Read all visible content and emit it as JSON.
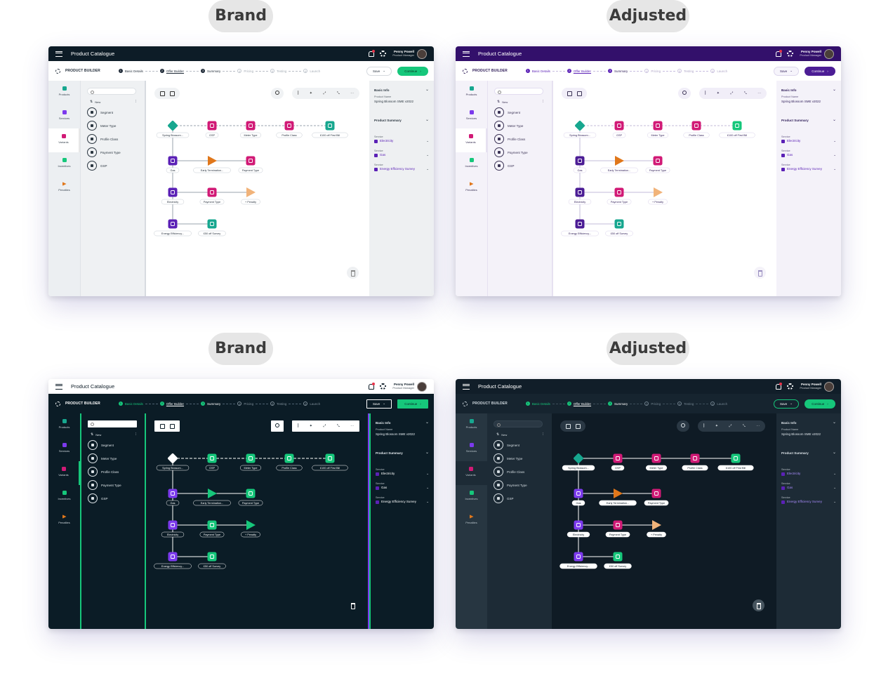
{
  "labels": {
    "top_left": "Brand",
    "top_right": "Adjusted",
    "bottom_left": "Brand",
    "bottom_right": "Adjusted"
  },
  "app": {
    "title": "Product Catalogue",
    "user_name": "Penny Powell",
    "user_role": "Product Manager",
    "builder_label": "PRODUCT BUILDER",
    "save_label": "Save",
    "continue_label": "Continue",
    "steps": [
      {
        "num": "1",
        "label": "Basic Details"
      },
      {
        "num": "2",
        "label": "Offer Builder"
      },
      {
        "num": "3",
        "label": "Summary"
      },
      {
        "num": "4",
        "label": "Pricing"
      },
      {
        "num": "5",
        "label": "Testing"
      },
      {
        "num": "6",
        "label": "Launch"
      }
    ],
    "nav": [
      "Products",
      "Services",
      "Variants",
      "Incentives",
      "Penalties"
    ],
    "new_label": "New",
    "items": [
      "Segment",
      "Meter Type",
      "Profile Class",
      "Payment Type",
      "GSP"
    ],
    "nodes": {
      "root": "Spring Blossom...",
      "gsp": "GSP",
      "meter": "Meter Type",
      "profile": "Profile Class",
      "first_bill": "£100 off First Bill",
      "gas": "Gas",
      "early": "Early Termination...",
      "pay1": "Payment Type",
      "elec": "Electricity",
      "pay2": "Payment Type",
      "penalty": "+ Penalty",
      "energy": "Energy Efficiency...",
      "survey": "£50 off Survey"
    },
    "panel": {
      "basic_info": "Basic Info",
      "product_name_label": "Product Name",
      "product_name": "Spring Blossom SME v2022",
      "product_summary": "Product Summary",
      "service_label": "Service",
      "services": [
        "Electricity",
        "Gas",
        "Energy Efficiency Survey"
      ]
    }
  },
  "colors": {
    "green": "#16c77b",
    "teal": "#17a78f",
    "purple": "#5b21b6",
    "magenta": "#d11a76",
    "orange": "#e0771b"
  }
}
